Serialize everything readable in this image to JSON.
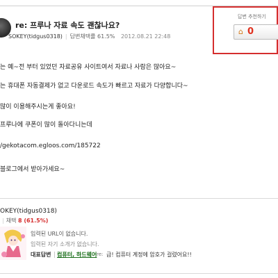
{
  "answer": {
    "title": "re: 프루나 자료 속도 괜찮나요?",
    "author": "SOKEY(tidgus0318)",
    "adoption_rate_label": "답변채택률",
    "adoption_rate": "61.5%",
    "date": "2012.08.21 22:48"
  },
  "recommend": {
    "label": "답변 추천하기",
    "count": "0"
  },
  "body": {
    "lines": [
      "는 예~전 부터 있었던 자료공유 사이트여서 자료나 사람은 많아요~",
      "는 휴대폰 자동결제가 없고 다운로드 속도가 빠르고 자료가 다양합니다~",
      "많이 이용해주시는게 좋아요!",
      "프루나에 쿠폰이 많이 돌아다니는데",
      "/gekotacom.egloos.com/185722",
      "블로그에서 받아가세요~"
    ]
  },
  "profile": {
    "name": "OKEY(tidgus0318)",
    "rate_label": "채택",
    "rate_value": "8 (61.5%)",
    "url_text": "입력된 URL이 없습니다.",
    "intro_text": "입력된 자기 소개가 없습니다.",
    "rep_label": "대표답변",
    "rep_category": "컴퓨터, 하드웨어",
    "rep_re": "re:",
    "rep_title": "급! 컴퓨터 계정에 암호가 걸렸어요!!"
  }
}
